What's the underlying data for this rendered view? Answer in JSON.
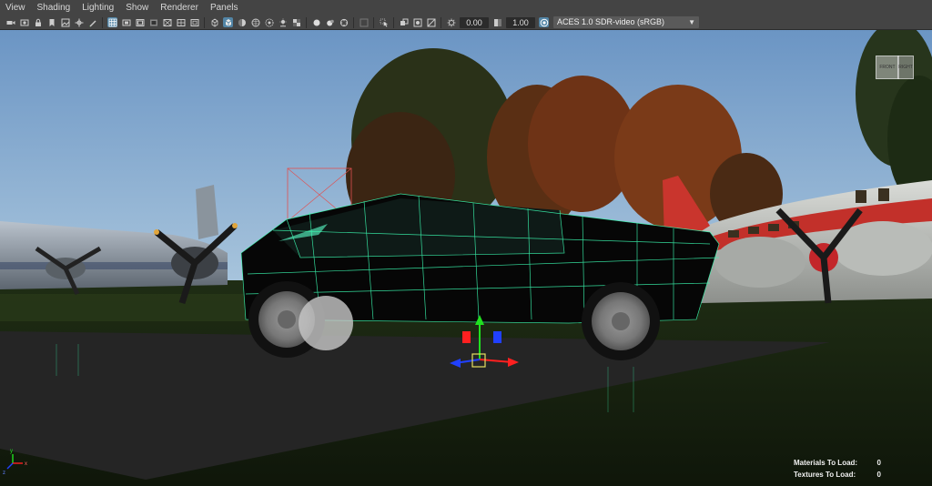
{
  "menu": [
    "View",
    "Shading",
    "Lighting",
    "Show",
    "Renderer",
    "Panels"
  ],
  "toolbar": {
    "exposure": "0.00",
    "gamma": "1.00",
    "color_space": "ACES 1.0 SDR-video (sRGB)"
  },
  "viewcube": {
    "front": "FRONT",
    "right": "RIGHT"
  },
  "hud": {
    "materials_label": "Materials To Load:",
    "materials_value": "0",
    "textures_label": "Textures To Load:",
    "textures_value": "0"
  },
  "axis": {
    "x": "x",
    "y": "y",
    "z": "z"
  },
  "colors": {
    "wireframe": "#3cffb4",
    "ground": "#252525",
    "manipulator_x": "#ff2020",
    "manipulator_y": "#20e020",
    "manipulator_z": "#2040ff"
  }
}
